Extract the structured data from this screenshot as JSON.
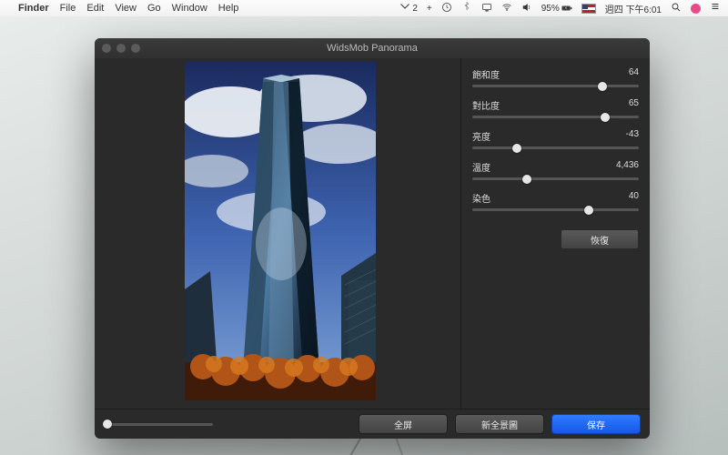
{
  "menubar": {
    "app": "Finder",
    "items": [
      "File",
      "Edit",
      "View",
      "Go",
      "Window",
      "Help"
    ],
    "cc_badge": "2",
    "battery_pct": "95%",
    "clock": "週四 下午6:01"
  },
  "window": {
    "title": "WidsMob Panorama"
  },
  "sliders": [
    {
      "label": "飽和度",
      "value_text": "64",
      "pos": 78
    },
    {
      "label": "對比度",
      "value_text": "65",
      "pos": 80
    },
    {
      "label": "亮度",
      "value_text": "-43",
      "pos": 27
    },
    {
      "label": "溫度",
      "value_text": "4,436",
      "pos": 33
    },
    {
      "label": "染色",
      "value_text": "40",
      "pos": 70
    }
  ],
  "buttons": {
    "restore": "恢復",
    "fullscreen": "全屏",
    "new_pano": "新全景圖",
    "save": "保存"
  },
  "zoom": {
    "pos": 3
  }
}
